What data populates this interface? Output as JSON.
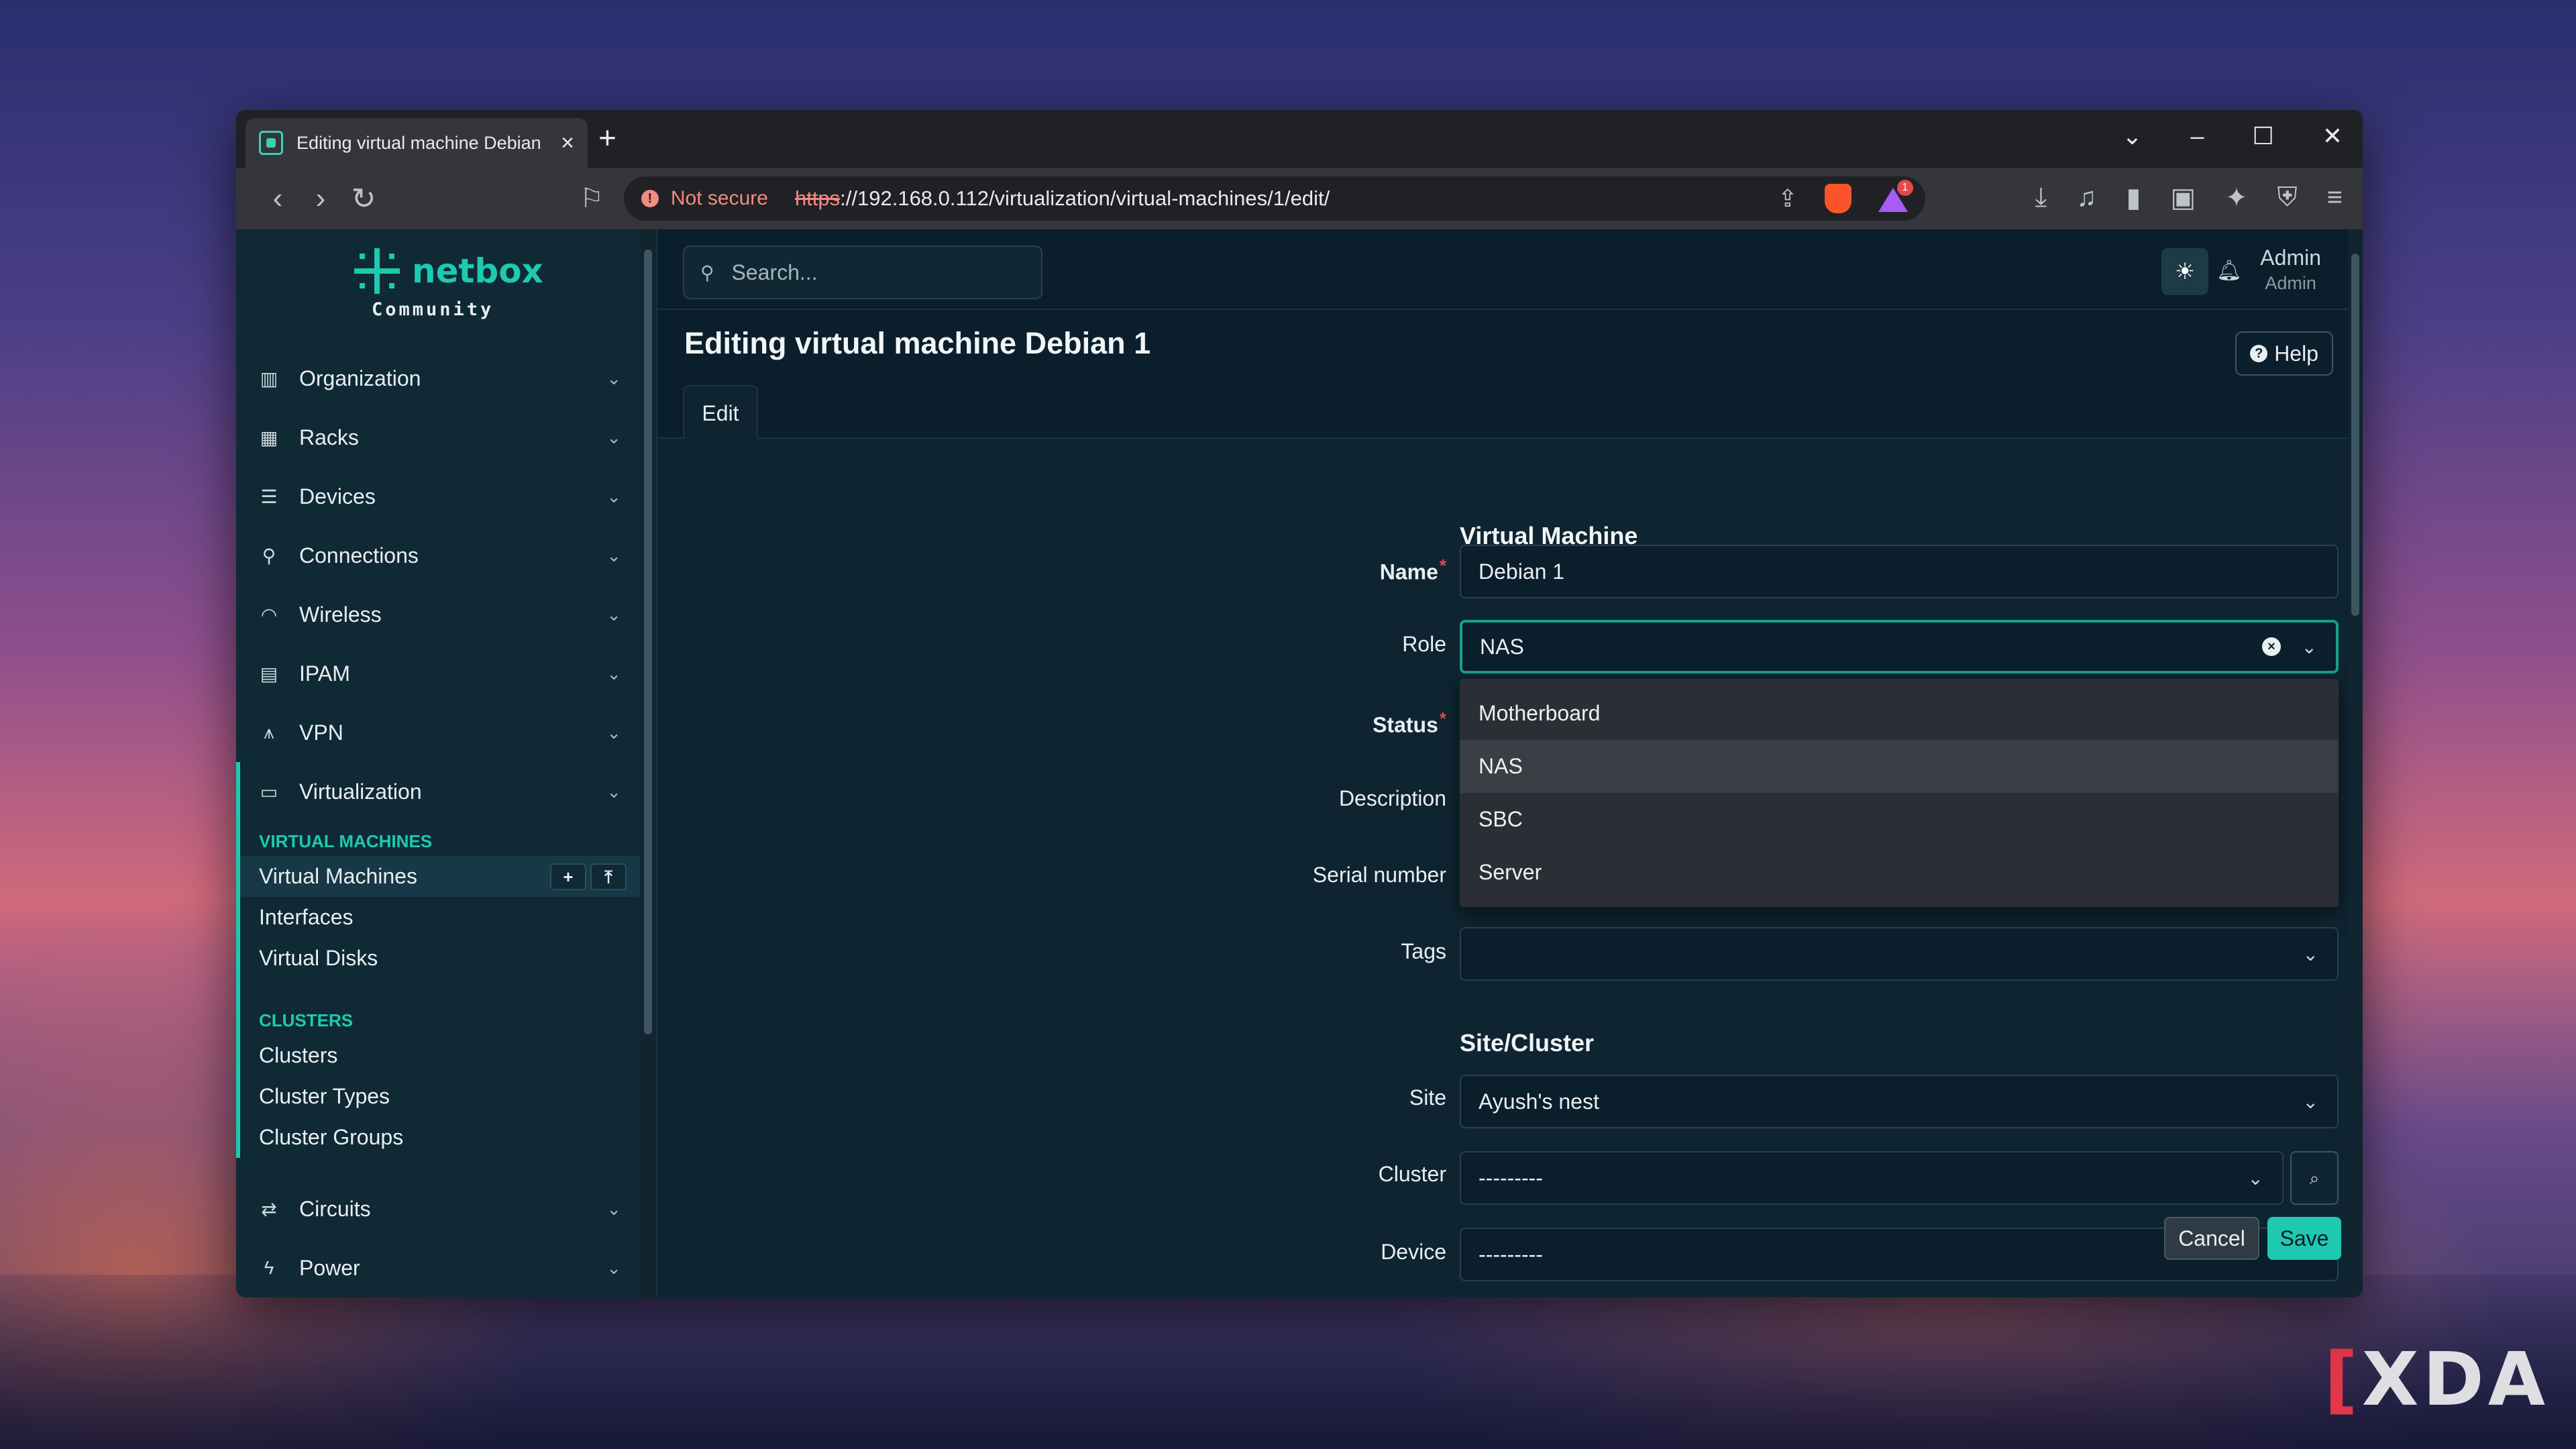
{
  "browser": {
    "tab_title": "Editing virtual machine Debian",
    "security_label": "Not secure",
    "url_protocol": "https",
    "url_rest": "://192.168.0.112/virtualization/virtual-machines/1/edit/",
    "rewards_badge": "1"
  },
  "sidebar": {
    "logo_text": "netbox",
    "logo_sub": "Community",
    "items_top": [
      {
        "label": "Organization",
        "icon": "building-icon"
      },
      {
        "label": "Racks",
        "icon": "rack-icon"
      },
      {
        "label": "Devices",
        "icon": "server-icon"
      },
      {
        "label": "Connections",
        "icon": "plug-icon"
      },
      {
        "label": "Wireless",
        "icon": "wifi-icon"
      },
      {
        "label": "IPAM",
        "icon": "ip-icon"
      },
      {
        "label": "VPN",
        "icon": "vpn-icon"
      },
      {
        "label": "Virtualization",
        "icon": "monitor-icon"
      }
    ],
    "groups": [
      {
        "heading": "VIRTUAL MACHINES",
        "links": [
          "Virtual Machines",
          "Interfaces",
          "Virtual Disks"
        ]
      },
      {
        "heading": "CLUSTERS",
        "links": [
          "Clusters",
          "Cluster Types",
          "Cluster Groups"
        ]
      }
    ],
    "items_bottom": [
      {
        "label": "Circuits",
        "icon": "circuit-icon"
      },
      {
        "label": "Power",
        "icon": "power-icon"
      }
    ]
  },
  "header": {
    "search_placeholder": "Search...",
    "user_name": "Admin",
    "user_role": "Admin"
  },
  "page": {
    "title": "Editing virtual machine Debian 1",
    "help_label": "Help",
    "tab_label": "Edit"
  },
  "form": {
    "section_vm": "Virtual Machine",
    "name_label": "Name",
    "name_value": "Debian 1",
    "role_label": "Role",
    "role_value": "NAS",
    "role_options": [
      "Motherboard",
      "NAS",
      "SBC",
      "Server"
    ],
    "status_label": "Status",
    "description_label": "Description",
    "serial_label": "Serial number",
    "tags_label": "Tags",
    "section_site": "Site/Cluster",
    "site_label": "Site",
    "site_value": "Ayush's nest",
    "cluster_label": "Cluster",
    "cluster_value": "---------",
    "device_label": "Device",
    "device_value": "---------",
    "cancel_label": "Cancel",
    "save_label": "Save"
  },
  "watermark": "XDA"
}
